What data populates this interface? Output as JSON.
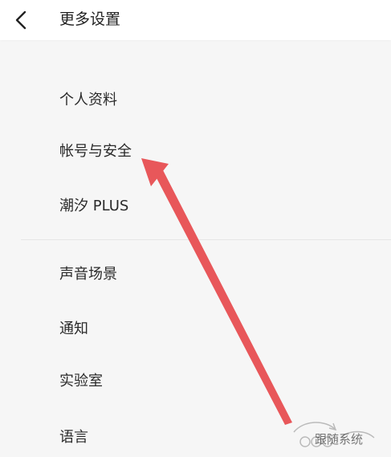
{
  "header": {
    "title": "更多设置",
    "back_icon": "chevron-left-icon"
  },
  "sections": [
    {
      "items": [
        {
          "label": "个人资料"
        },
        {
          "label": "帐号与安全"
        },
        {
          "label": "潮汐 PLUS"
        }
      ]
    },
    {
      "items": [
        {
          "label": "声音场景"
        },
        {
          "label": "通知"
        },
        {
          "label": "实验室"
        },
        {
          "label": "语言"
        }
      ]
    }
  ],
  "annotation": {
    "arrow_color": "#e8575a",
    "watermark_text": "跟随系统"
  }
}
